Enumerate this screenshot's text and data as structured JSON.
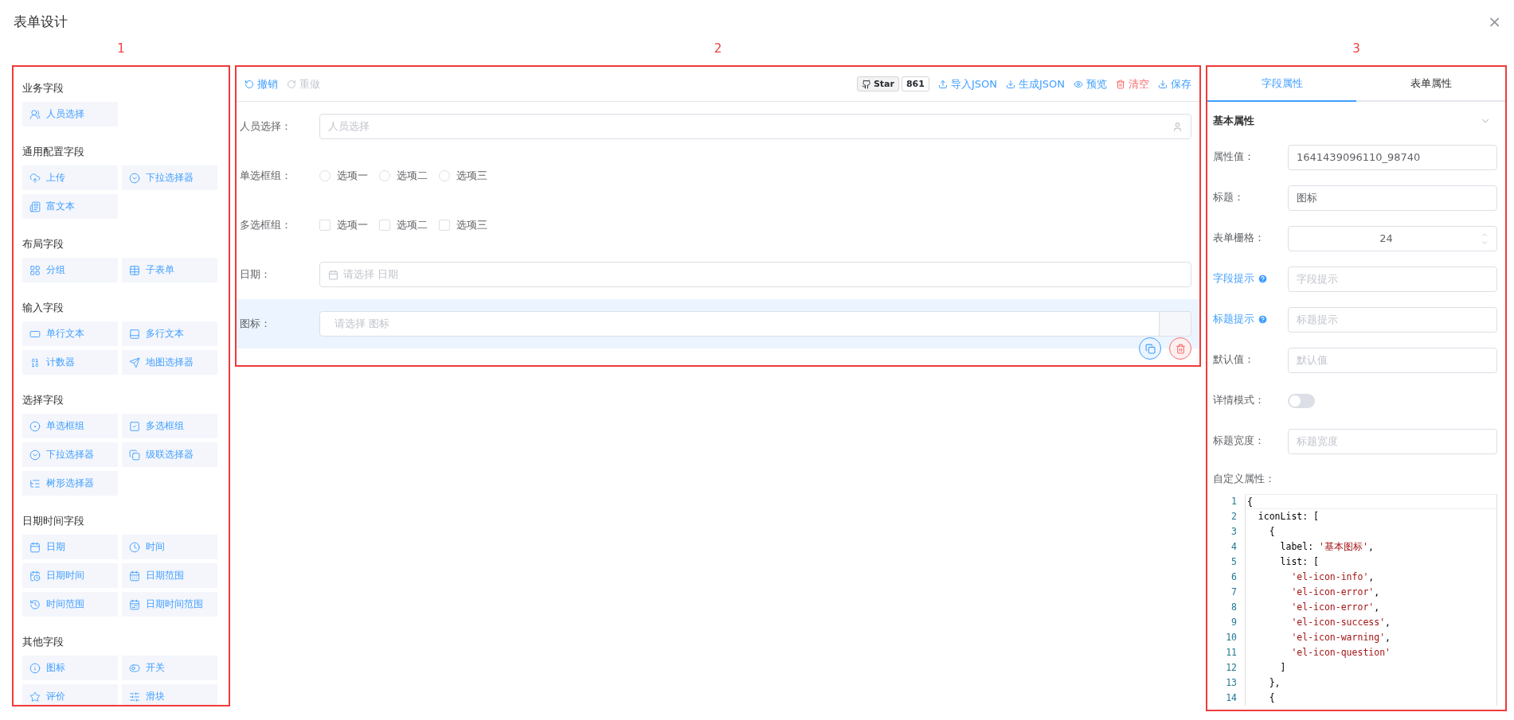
{
  "window": {
    "title": "表单设计",
    "close": "×"
  },
  "annotations": [
    "1",
    "2",
    "3"
  ],
  "palette": {
    "sections": [
      {
        "title": "业务字段",
        "items": [
          "人员选择"
        ]
      },
      {
        "title": "通用配置字段",
        "items": [
          "上传",
          "下拉选择器",
          "富文本"
        ]
      },
      {
        "title": "布局字段",
        "items": [
          "分组",
          "子表单"
        ]
      },
      {
        "title": "输入字段",
        "items": [
          "单行文本",
          "多行文本",
          "计数器",
          "地图选择器"
        ]
      },
      {
        "title": "选择字段",
        "items": [
          "单选框组",
          "多选框组",
          "下拉选择器",
          "级联选择器",
          "树形选择器"
        ]
      },
      {
        "title": "日期时间字段",
        "items": [
          "日期",
          "时间",
          "日期时间",
          "日期范围",
          "时间范围",
          "日期时间范围"
        ]
      },
      {
        "title": "其他字段",
        "items": [
          "图标",
          "开关",
          "评价",
          "滑块"
        ]
      }
    ]
  },
  "toolbar": {
    "left": [
      {
        "label": "撤销",
        "disabled": false
      },
      {
        "label": "重做",
        "disabled": true
      }
    ],
    "github": {
      "label": "Star",
      "count": "861"
    },
    "right": [
      {
        "label": "导入JSON",
        "kind": "normal"
      },
      {
        "label": "生成JSON",
        "kind": "normal"
      },
      {
        "label": "预览",
        "kind": "normal"
      },
      {
        "label": "清空",
        "kind": "danger"
      },
      {
        "label": "保存",
        "kind": "normal"
      }
    ]
  },
  "form": {
    "fields": [
      {
        "kind": "user",
        "label": "人员选择：",
        "placeholder": "人员选择",
        "selected": false
      },
      {
        "kind": "radio",
        "label": "单选框组：",
        "options": [
          {
            "label": "选项一",
            "checked": false
          },
          {
            "label": "选项二",
            "checked": false
          },
          {
            "label": "选项三",
            "checked": false
          }
        ],
        "selected": false
      },
      {
        "kind": "checkbox",
        "label": "多选框组：",
        "options": [
          {
            "label": "选项一",
            "checked": false
          },
          {
            "label": "选项二",
            "checked": false
          },
          {
            "label": "选项三",
            "checked": false
          }
        ],
        "selected": false
      },
      {
        "kind": "date",
        "label": "日期：",
        "placeholder": "请选择 日期",
        "selected": false
      },
      {
        "kind": "icon",
        "label": "图标：",
        "placeholder": "请选择 图标",
        "selected": true
      }
    ]
  },
  "properties": {
    "tabs": [
      {
        "label": "字段属性",
        "selected": true
      },
      {
        "label": "表单属性",
        "selected": false
      }
    ],
    "section": {
      "title": "基本属性",
      "expanded": true
    },
    "rows": [
      {
        "kind": "input",
        "label": "属性值：",
        "value": "1641439096110_98740"
      },
      {
        "kind": "input",
        "label": "标题：",
        "value": "图标"
      },
      {
        "kind": "number",
        "label": "表单栅格：",
        "value": "24"
      },
      {
        "kind": "help",
        "label": "字段提示",
        "placeholder": "字段提示"
      },
      {
        "kind": "help",
        "label": "标题提示",
        "placeholder": "标题提示"
      },
      {
        "kind": "input",
        "label": "默认值：",
        "placeholder": "默认值"
      },
      {
        "kind": "switch",
        "label": "详情模式：",
        "on": false
      },
      {
        "kind": "input",
        "label": "标题宽度：",
        "placeholder": "标题宽度"
      }
    ],
    "custom": {
      "label": "自定义属性：",
      "lines": [
        {
          "number": "1",
          "parts": [
            {
              "kind": "plain",
              "text": "{"
            }
          ]
        },
        {
          "number": "2",
          "parts": [
            {
              "kind": "plain",
              "text": "  iconList: ["
            }
          ]
        },
        {
          "number": "3",
          "parts": [
            {
              "kind": "plain",
              "text": "    {"
            }
          ]
        },
        {
          "number": "4",
          "parts": [
            {
              "kind": "plain",
              "text": "      label: "
            },
            {
              "kind": "string",
              "text": "'基本图标'"
            },
            {
              "kind": "plain",
              "text": ","
            }
          ]
        },
        {
          "number": "5",
          "parts": [
            {
              "kind": "plain",
              "text": "      list: ["
            }
          ]
        },
        {
          "number": "6",
          "parts": [
            {
              "kind": "string",
              "text": "        'el-icon-info'"
            },
            {
              "kind": "plain",
              "text": ","
            }
          ]
        },
        {
          "number": "7",
          "parts": [
            {
              "kind": "string",
              "text": "        'el-icon-error'"
            },
            {
              "kind": "plain",
              "text": ","
            }
          ]
        },
        {
          "number": "8",
          "parts": [
            {
              "kind": "string",
              "text": "        'el-icon-error'"
            },
            {
              "kind": "plain",
              "text": ","
            }
          ]
        },
        {
          "number": "9",
          "parts": [
            {
              "kind": "string",
              "text": "        'el-icon-success'"
            },
            {
              "kind": "plain",
              "text": ","
            }
          ]
        },
        {
          "number": "10",
          "parts": [
            {
              "kind": "string",
              "text": "        'el-icon-warning'"
            },
            {
              "kind": "plain",
              "text": ","
            }
          ]
        },
        {
          "number": "11",
          "parts": [
            {
              "kind": "string",
              "text": "        'el-icon-question'"
            }
          ]
        },
        {
          "number": "12",
          "parts": [
            {
              "kind": "plain",
              "text": "      ]"
            }
          ]
        },
        {
          "number": "13",
          "parts": [
            {
              "kind": "plain",
              "text": "    },"
            }
          ]
        },
        {
          "number": "14",
          "parts": [
            {
              "kind": "plain",
              "text": "    {"
            }
          ]
        }
      ]
    }
  }
}
